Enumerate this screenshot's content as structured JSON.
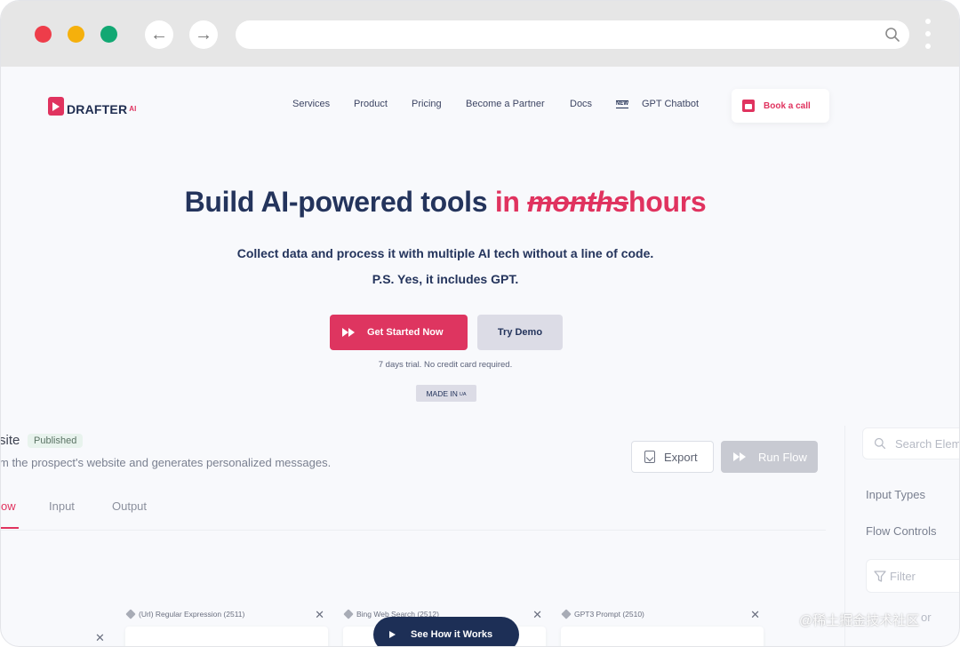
{
  "browser": {
    "url": ""
  },
  "site": {
    "logo_text": "DRAFTER",
    "logo_ai": "AI",
    "nav": [
      "Services",
      "Product",
      "Pricing",
      "Become a Partner",
      "Docs",
      "GPT Chatbot"
    ],
    "new_badge": "NEW",
    "book_call": "Book a call"
  },
  "hero": {
    "title_main": "Build AI-powered tools",
    "title_in": "in",
    "title_struck": "months",
    "title_end": "hours",
    "subtitle_1": "Collect data and process it with multiple AI tech without a line of code.",
    "subtitle_2": "P.S. Yes, it includes GPT.",
    "cta_primary": "Get Started Now",
    "cta_secondary": "Try Demo",
    "trial_note": "7 days trial. No credit card required.",
    "made_in": "MADE IN",
    "made_in_country": "UA"
  },
  "app": {
    "flow_title": "site",
    "status": "Published",
    "description": "m the prospect's website and generates personalized messages.",
    "export_label": "Export",
    "run_flow_label": "Run Flow",
    "tabs": [
      "ow",
      "Input",
      "Output"
    ],
    "search_placeholder": "Search Elem",
    "side_headings": [
      "Input Types",
      "Flow Controls"
    ],
    "filter_placeholder": "Filter",
    "side_item": "or",
    "nodes": [
      {
        "label": "(Url) Regular Expression (2511)"
      },
      {
        "label": "Bing Web Search (2512)"
      },
      {
        "label": "GPT3 Prompt (2510)"
      }
    ],
    "close_symbol": "✕",
    "see_how": "See How it Works"
  },
  "watermark": "@稀土掘金技术社区",
  "colors": {
    "accent": "#e0335f",
    "navy": "#1d2f56"
  }
}
